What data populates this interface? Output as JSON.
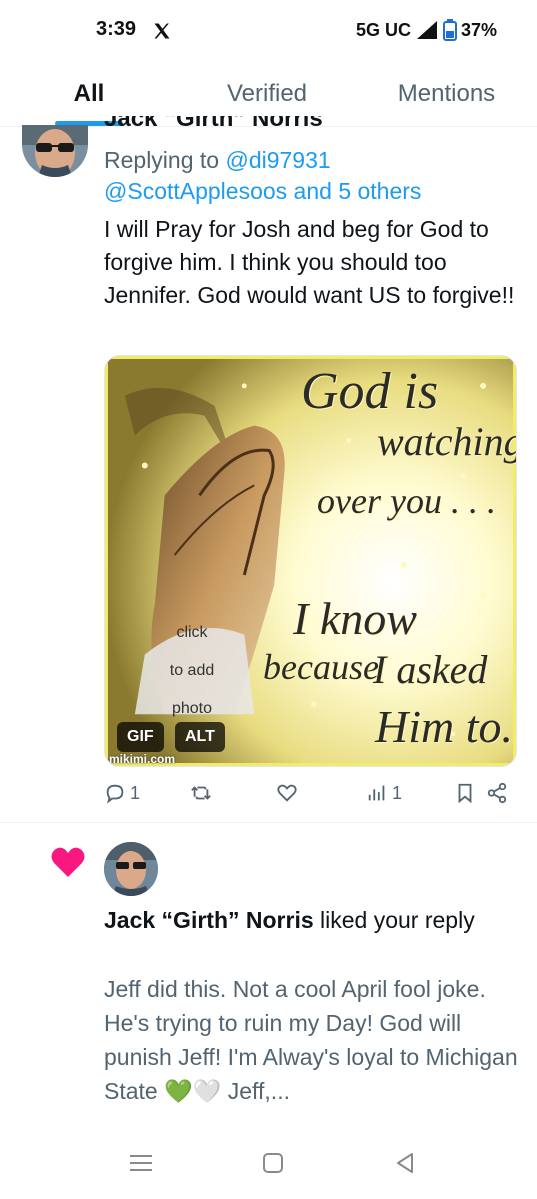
{
  "status_bar": {
    "time": "3:39",
    "network": "5G UC",
    "battery": "37%",
    "icons": [
      "x-logo-icon",
      "signal-icon",
      "battery-icon"
    ]
  },
  "tabs": [
    {
      "label": "All",
      "active": true
    },
    {
      "label": "Verified",
      "active": false
    },
    {
      "label": "Mentions",
      "active": false
    }
  ],
  "tweet": {
    "author_clipped": "Jack “Girth” Norris",
    "replying_prefix": "Replying to ",
    "replying_handle": "@di97931",
    "replying_more": "@ScottApplesoos and 5 others",
    "text": "I will Pray for Josh and beg for God to forgive him. I think you should too Jennifer. God would want US to forgive!!",
    "media": {
      "lines": [
        "God is",
        "watching",
        "over you . . .",
        "I know",
        "because",
        "I asked",
        "Him to."
      ],
      "click_lines": [
        "click",
        "to add",
        "photo"
      ],
      "badge_gif": "GIF",
      "badge_alt": "ALT",
      "watermark": "mikimi.com"
    },
    "actions": {
      "replies": "1",
      "retweets": "",
      "likes": "",
      "views": "1"
    }
  },
  "notification": {
    "user": "Jack “Girth” Norris",
    "action": " liked your reply",
    "text": "Jeff did this. Not a cool April fool joke. He's trying to ruin my Day! God will punish Jeff! I'm Alway's loyal to Michigan State 💚🤍 Jeff,..."
  },
  "colors": {
    "accent": "#1d9bf0",
    "like": "#f91880",
    "muted": "#536471"
  }
}
